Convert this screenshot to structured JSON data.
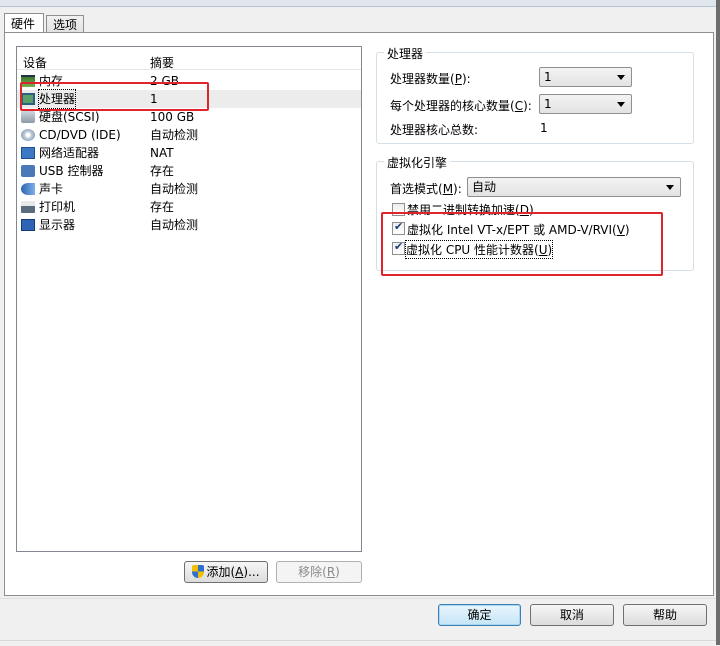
{
  "tabs": [
    "硬件",
    "选项"
  ],
  "device_list": {
    "col_device": "设备",
    "col_summary": "摘要",
    "rows": [
      {
        "icon": "memory-icon",
        "name": "内存",
        "summary": "2 GB"
      },
      {
        "icon": "cpu-icon",
        "name": "处理器",
        "summary": "1"
      },
      {
        "icon": "hard-disk-icon",
        "name": "硬盘(SCSI)",
        "summary": "100 GB"
      },
      {
        "icon": "cd-dvd-icon",
        "name": "CD/DVD (IDE)",
        "summary": "自动检测"
      },
      {
        "icon": "network-adapter-icon",
        "name": "网络适配器",
        "summary": "NAT"
      },
      {
        "icon": "usb-controller-icon",
        "name": "USB 控制器",
        "summary": "存在"
      },
      {
        "icon": "sound-card-icon",
        "name": "声卡",
        "summary": "自动检测"
      },
      {
        "icon": "printer-icon",
        "name": "打印机",
        "summary": "存在"
      },
      {
        "icon": "display-icon",
        "name": "显示器",
        "summary": "自动检测"
      }
    ],
    "selected_index": 1
  },
  "buttons": {
    "add_pre": "添加(",
    "add_key": "A",
    "add_post": ")...",
    "remove_pre": "移除(",
    "remove_key": "R",
    "remove_post": ")",
    "ok": "确定",
    "cancel": "取消",
    "help": "帮助"
  },
  "processor": {
    "title": "处理器",
    "count_pre": "处理器数量(",
    "count_key": "P",
    "count_post": "):",
    "count_value": "1",
    "cores_pre": "每个处理器的核心数量(",
    "cores_key": "C",
    "cores_post": "):",
    "cores_value": "1",
    "total_label": "处理器核心总数:",
    "total_value": "1"
  },
  "virtualization": {
    "title": "虚拟化引擎",
    "mode_pre": "首选模式(",
    "mode_key": "M",
    "mode_post": "):",
    "mode_value": "自动",
    "opt1_pre": "禁用二进制转换加速(",
    "opt1_key": "D",
    "opt1_post": ")",
    "opt1_checked": false,
    "opt2_pre": "虚拟化 Intel VT-x/EPT 或 AMD-V/RVI(",
    "opt2_key": "V",
    "opt2_post": ")",
    "opt2_checked": true,
    "opt3_pre": "虚拟化 CPU 性能计数器(",
    "opt3_key": "U",
    "opt3_post": ")",
    "opt3_checked": true
  },
  "annotation_color": "#e0242c"
}
